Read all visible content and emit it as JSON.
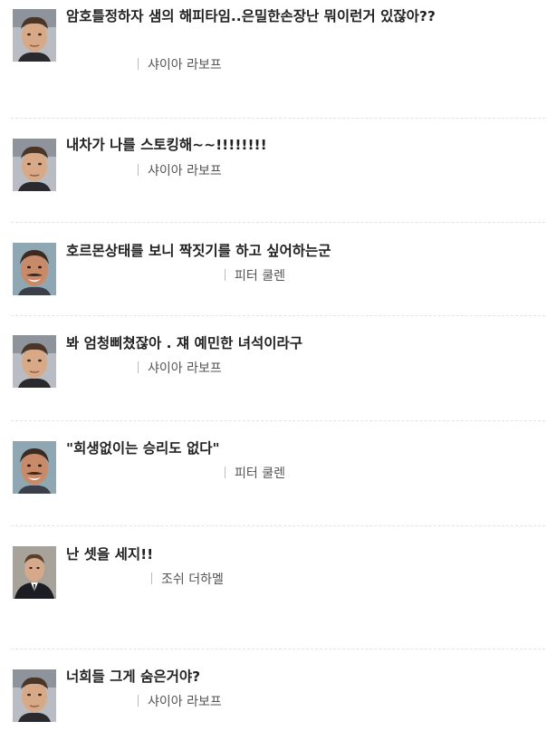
{
  "quotes": [
    {
      "text": "암호틀정하자 샘의 해피타임..은밀한손장난 뭐이런거 있잖아??",
      "speaker": "샤이아 라보프",
      "avatar_icon": "shia-labeouf-avatar"
    },
    {
      "text": "내차가 나를 스토킹해~~!!!!!!!!",
      "speaker": "샤이아 라보프",
      "avatar_icon": "shia-labeouf-avatar"
    },
    {
      "text": "호르몬상태를 보니 짝짓기를 하고 싶어하는군",
      "speaker": "피터 쿨렌",
      "avatar_icon": "peter-cullen-avatar"
    },
    {
      "text": "봐 엄청삐쳤잖아 . 쟤 예민한 녀석이라구",
      "speaker": "샤이아 라보프",
      "avatar_icon": "shia-labeouf-avatar"
    },
    {
      "text": "\"희생없이는 승리도 없다\"",
      "speaker": "피터 쿨렌",
      "avatar_icon": "peter-cullen-avatar"
    },
    {
      "text": "난 셋을 세지!!",
      "speaker": "조쉬 더하멜",
      "avatar_icon": "josh-duhamel-avatar"
    },
    {
      "text": "너희들 그게 숨은거야?",
      "speaker": "샤이아 라보프",
      "avatar_icon": "shia-labeouf-avatar"
    }
  ]
}
